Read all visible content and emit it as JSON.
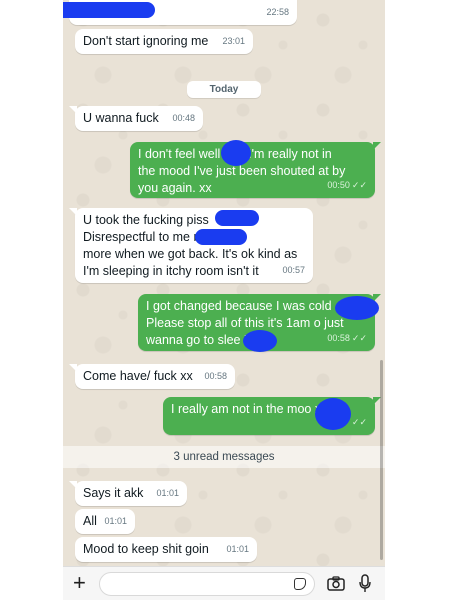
{
  "messages": [
    {
      "dir": "in",
      "text": "Don't start ignoring me",
      "time": "23:01"
    },
    {
      "dir": "in",
      "text": "U wanna fuck",
      "time": "00:48"
    },
    {
      "dir": "out",
      "text": "I don't feel well       and I'm really not in\nthe mood I've just been shouted at by\nyou again. xx",
      "time": "00:50"
    },
    {
      "dir": "in",
      "text": "U took the fucking piss\nDisrespectful to me n              n then\nmore when we got back. It's ok kind as\nI'm sleeping in itchy room isn't it",
      "time": "00:57"
    },
    {
      "dir": "out",
      "text": "I got changed because I was cold\nPlease stop all of this it's 1am o just\nwanna go to slee         Xx",
      "time": "00:58"
    },
    {
      "dir": "in",
      "text": "Come have/ fuck xx",
      "time": "00:58"
    },
    {
      "dir": "out",
      "text": "I really am not in the moo              xx",
      "time": ""
    },
    {
      "dir": "in",
      "text": "Says it akk",
      "time": "01:01"
    },
    {
      "dir": "in",
      "text": "All",
      "time": "01:01"
    },
    {
      "dir": "in",
      "text": "Mood to keep shit goin",
      "time": "01:01"
    }
  ],
  "top_partial_time": "22:58",
  "date_separator": "Today",
  "unread_label": "3 unread messages",
  "read_ticks": "✓✓",
  "input": {
    "placeholder": ""
  },
  "icons": {
    "plus": "plus-icon",
    "sticker": "sticker-icon",
    "camera": "camera-icon",
    "mic": "mic-icon"
  },
  "colors": {
    "outgoing": "#4caf50",
    "incoming": "#ffffff",
    "wallpaper": "#e9e2d6",
    "redaction": "#1a3cf0"
  }
}
